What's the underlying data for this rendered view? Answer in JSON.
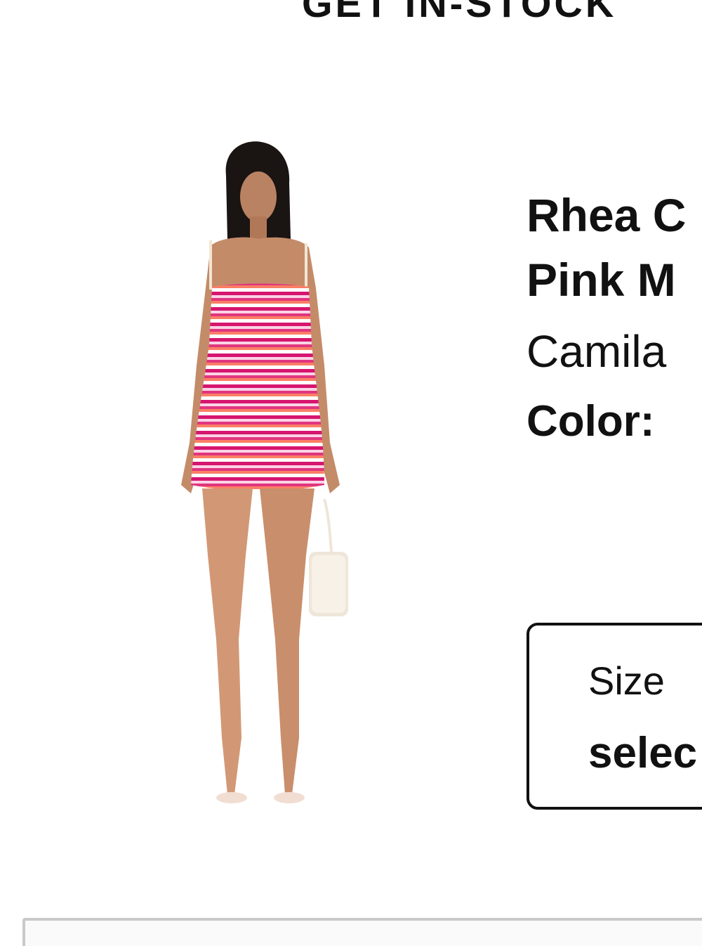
{
  "banner": {
    "text": "GET IN-STOCK"
  },
  "product": {
    "name_line1": "Rhea C",
    "name_line2": "Pink M",
    "brand": "Camila",
    "color_label": "Color:",
    "image_alt": "Model wearing pink striped crochet mini dress holding white beaded bag"
  },
  "size_selector": {
    "label": "Size",
    "value": "selec"
  },
  "colors": {
    "text": "#111111",
    "border": "#111111",
    "panel_border": "#c9c9c9"
  }
}
